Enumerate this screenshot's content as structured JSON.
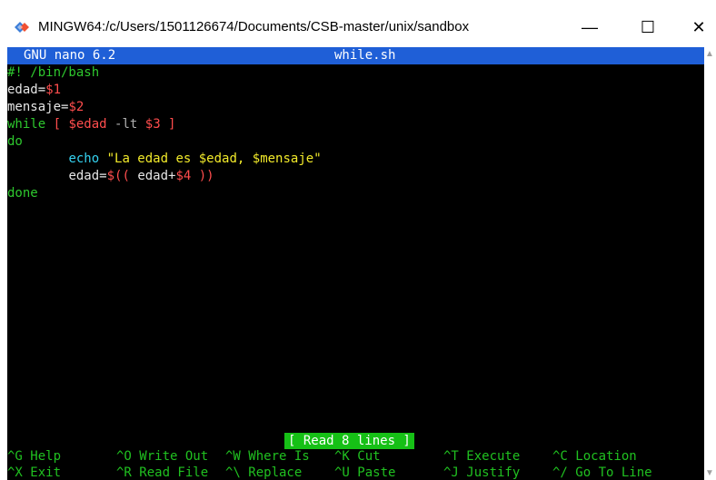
{
  "window": {
    "title": "MINGW64:/c/Users/1501126674/Documents/CSB-master/unix/sandbox",
    "minimize_glyph": "—",
    "maximize_glyph": "☐",
    "close_glyph": "✕",
    "icon": "git-bash-icon"
  },
  "nano": {
    "app_name": "GNU nano 6.2",
    "file_name": "while.sh",
    "status": "[ Read 8 lines ]"
  },
  "code": {
    "line1": "#! /bin/bash",
    "line2_var": "edad=",
    "line2_val": "$1",
    "line3_var": "mensaje=",
    "line3_val": "$2",
    "line4_kw": "while",
    "line4_rest_a": " [ ",
    "line4_var": "$edad",
    "line4_op": " -lt ",
    "line4_arg": "$3",
    "line4_end": " ]",
    "line5": "do",
    "line6_indent": "        ",
    "line6_cmd": "echo",
    "line6_sp": " ",
    "line6_str_a": "\"La edad es ",
    "line6_var1": "$edad",
    "line6_str_b": ", ",
    "line6_var2": "$mensaje",
    "line6_str_c": "\"",
    "line7_indent": "        ",
    "line7_var": "edad=",
    "line7_a": "$(( ",
    "line7_b": "edad+",
    "line7_c": "$4",
    "line7_d": " ))",
    "line8": "done"
  },
  "shortcuts": [
    {
      "key": "^G",
      "label": " Help"
    },
    {
      "key": "^O",
      "label": " Write Out"
    },
    {
      "key": "^W",
      "label": " Where Is"
    },
    {
      "key": "^K",
      "label": " Cut"
    },
    {
      "key": "^T",
      "label": " Execute"
    },
    {
      "key": "^C",
      "label": " Location"
    },
    {
      "key": "^X",
      "label": " Exit"
    },
    {
      "key": "^R",
      "label": " Read File"
    },
    {
      "key": "^\\",
      "label": " Replace"
    },
    {
      "key": "^U",
      "label": " Paste"
    },
    {
      "key": "^J",
      "label": " Justify"
    },
    {
      "key": "^/",
      "label": " Go To Line"
    }
  ],
  "colors": {
    "header_bg": "#1f5fd7",
    "status_bg": "#16c016",
    "terminal_bg": "#000000"
  }
}
